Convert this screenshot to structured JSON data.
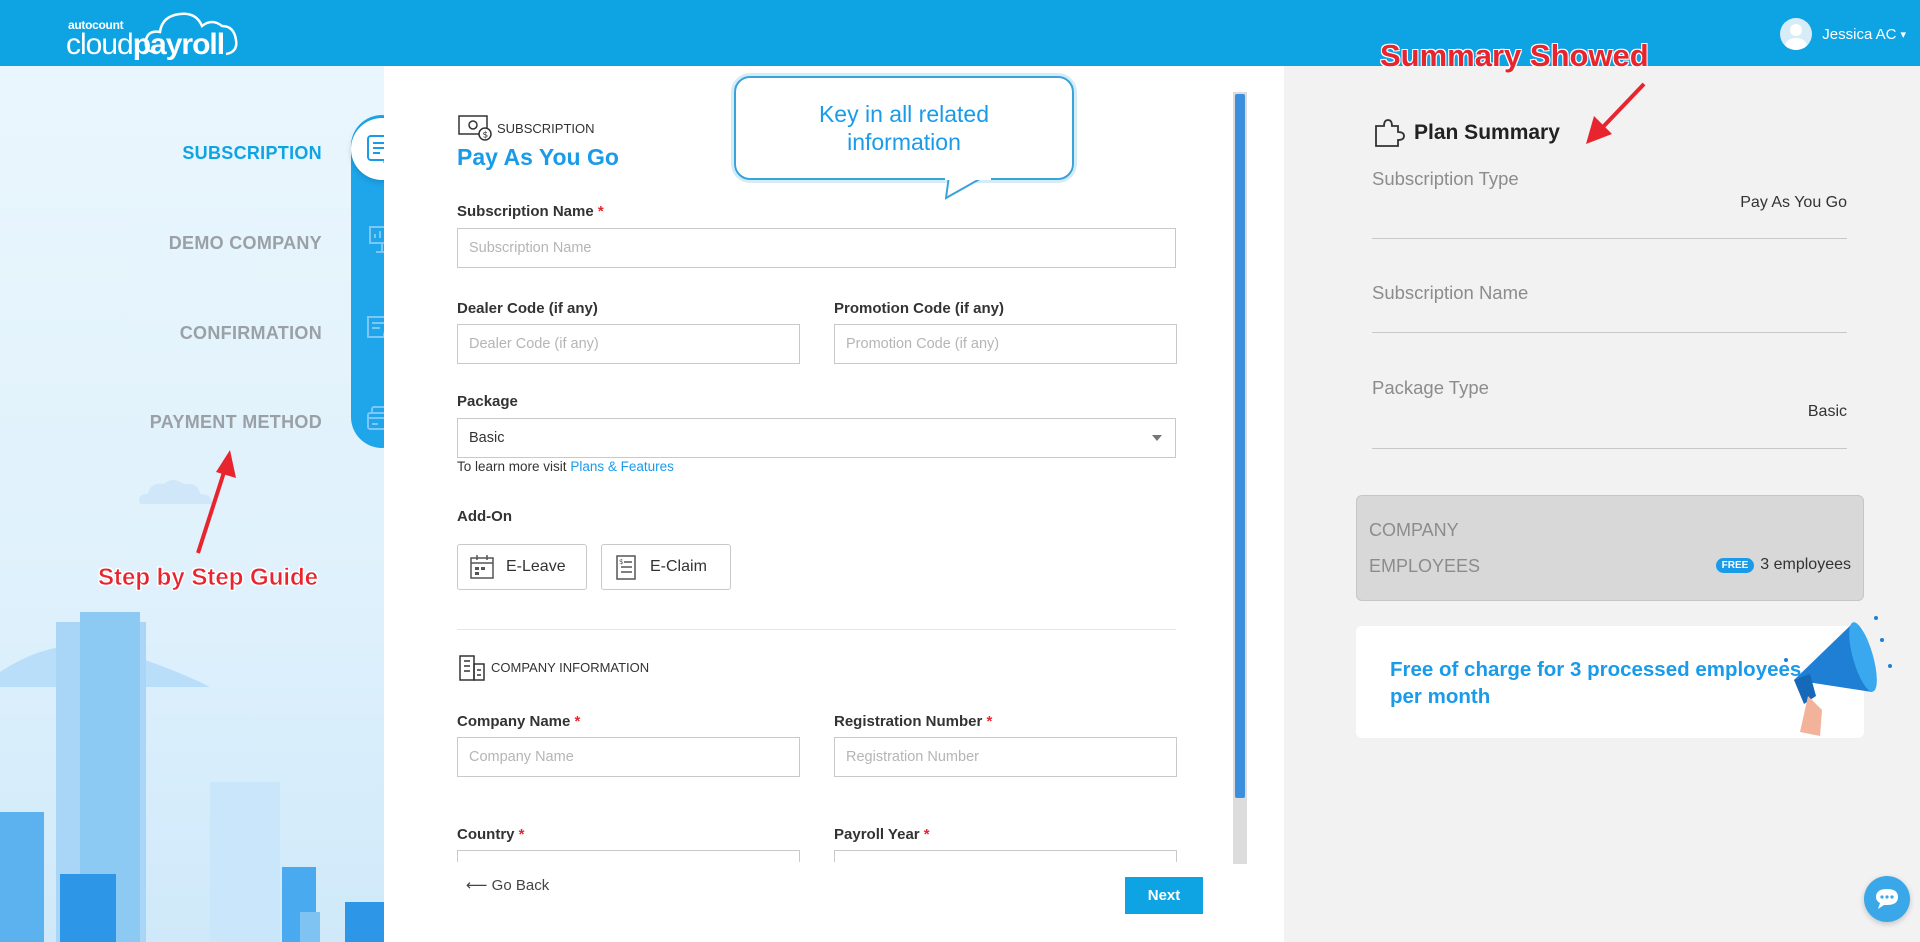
{
  "header": {
    "logo_small": "autocount",
    "logo_main_a": "cloud",
    "logo_main_b": "payroll",
    "user_name": "Jessica AC"
  },
  "steps": [
    {
      "label": "SUBSCRIPTION",
      "active": true
    },
    {
      "label": "DEMO COMPANY",
      "active": false
    },
    {
      "label": "CONFIRMATION",
      "active": false
    },
    {
      "label": "PAYMENT METHOD",
      "active": false
    }
  ],
  "annotations": {
    "step_guide": "Step by Step Guide",
    "callout_line1": "Key in all related",
    "callout_line2": "information",
    "summary": "Summary Showed"
  },
  "form": {
    "section_subscription": "SUBSCRIPTION",
    "plan_title": "Pay As You Go",
    "subscription_name": {
      "label": "Subscription Name",
      "placeholder": "Subscription Name"
    },
    "dealer_code": {
      "label": "Dealer Code (if any)",
      "placeholder": "Dealer Code (if any)"
    },
    "promotion_code": {
      "label": "Promotion Code (if any)",
      "placeholder": "Promotion Code (if any)"
    },
    "package": {
      "label": "Package",
      "value": "Basic"
    },
    "learn_prefix": "To learn more visit",
    "learn_link": "Plans & Features",
    "addon_label": "Add-On",
    "addons": [
      "E-Leave",
      "E-Claim"
    ],
    "section_company": "COMPANY INFORMATION",
    "company_name": {
      "label": "Company Name",
      "placeholder": "Company Name"
    },
    "registration_number": {
      "label": "Registration Number",
      "placeholder": "Registration Number"
    },
    "country": {
      "label": "Country"
    },
    "payroll_year": {
      "label": "Payroll Year"
    },
    "required_mark": "*",
    "go_back": "⟵ Go Back",
    "next": "Next"
  },
  "summary": {
    "title": "Plan Summary",
    "subscription_type": {
      "key": "Subscription Type",
      "value": "Pay As You Go"
    },
    "subscription_name": {
      "key": "Subscription Name",
      "value": ""
    },
    "package_type": {
      "key": "Package Type",
      "value": "Basic"
    },
    "company_key": "COMPANY",
    "employees_key": "EMPLOYEES",
    "free_badge": "FREE",
    "employees_value": "3 employees",
    "free_text": "Free of charge for 3 processed employees per month"
  },
  "colors": {
    "brand": "#0ea4e4",
    "accent_text": "#1a9bea",
    "required": "#e8252e",
    "annotation": "#e8252e"
  }
}
